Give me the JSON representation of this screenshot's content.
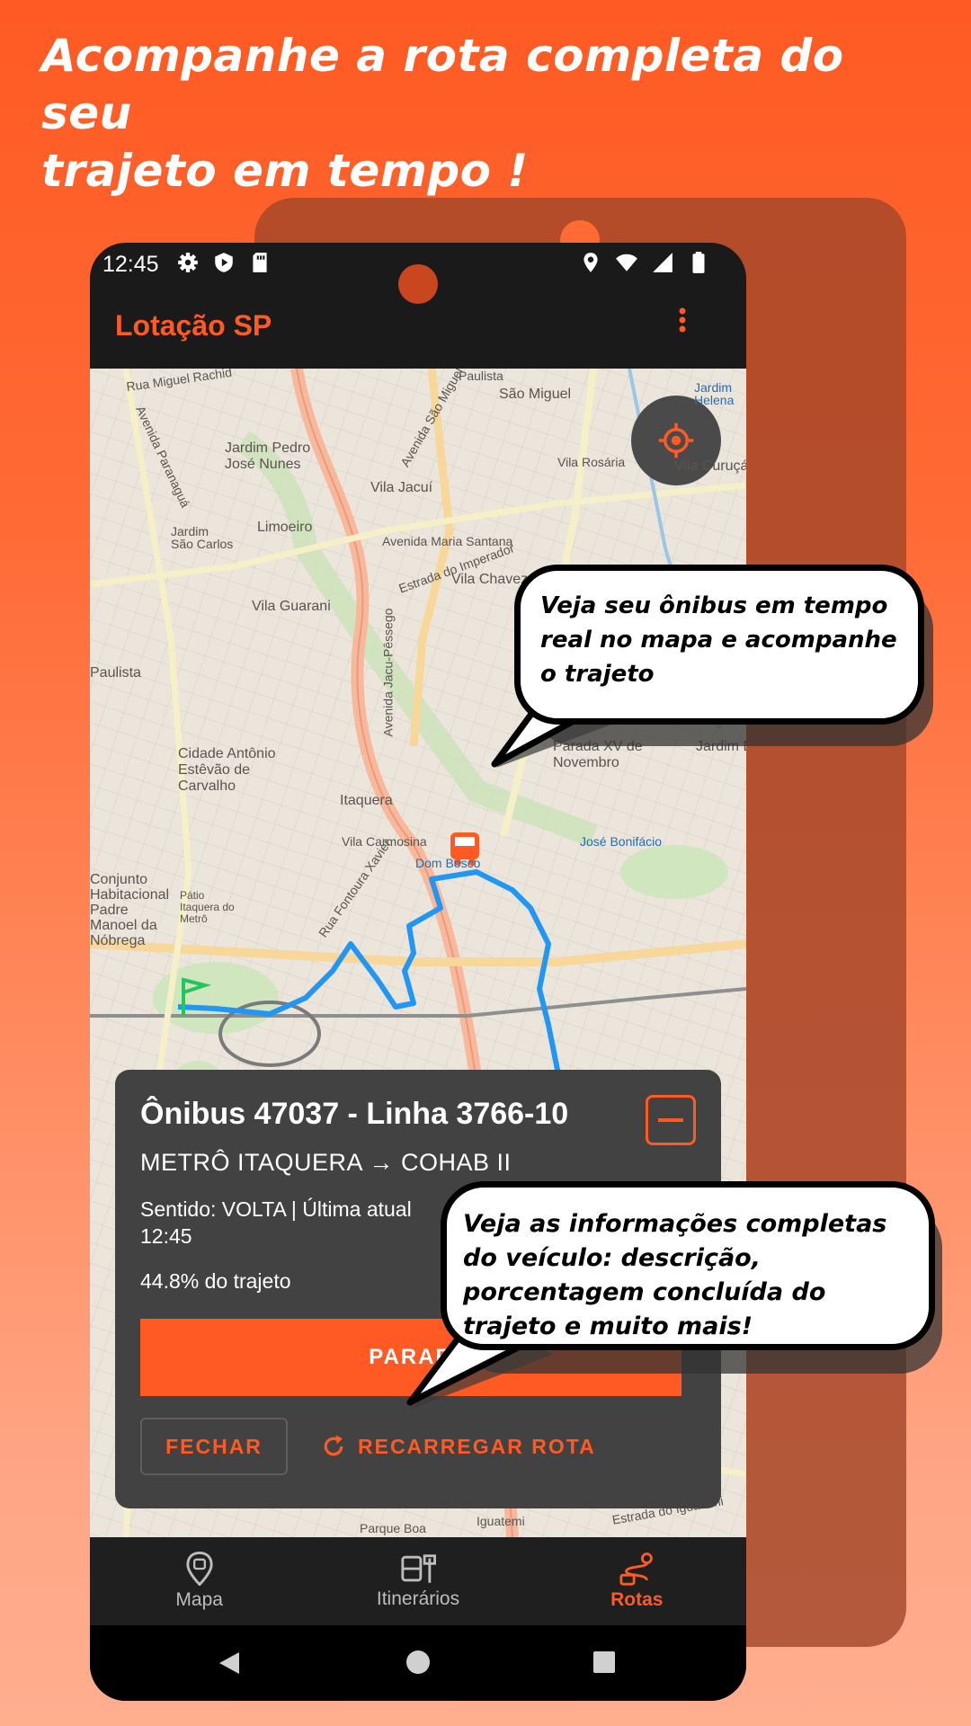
{
  "headline": {
    "line1": "Acompanhe a rota completa do seu",
    "line2": "trajeto em tempo !"
  },
  "status_bar": {
    "time": "12:45"
  },
  "app": {
    "title": "Lotação SP",
    "accent": "#ff5a23"
  },
  "map": {
    "labels": [
      "Rua Miguel Rachid",
      "Paulista",
      "São Miguel",
      "Jardim Helena",
      "Avenida Paranaguá",
      "Jardim Pedro José Nunes",
      "Avenida São Miguel",
      "Vila Rosária",
      "Vila Curuçá",
      "Vila Jacuí",
      "Jardim São Carlos",
      "Limoeiro",
      "Avenida Maria Santana",
      "Estrada do Imperador",
      "Vila Chavez",
      "Vila Guarani",
      "Paulista",
      "Avenida Jacu-Pêssego",
      "Parada XV de Novembro",
      "Jardim Et",
      "Cidade Antônio Estêvão de Carvalho",
      "Itaquera",
      "Vila Carmosina",
      "Dom Bosco",
      "José Bonifácio",
      "Conjunto Habitacional Padre Manoel da Nóbrega",
      "Pátio Itaquera do Metrô",
      "Rua Fontoura Xavier",
      "Iguatemi",
      "Estrada do Iguatemi",
      "Parque Boa"
    ]
  },
  "bubbles": {
    "top": "Veja seu ônibus em tempo real no mapa e acompanhe o trajeto",
    "bottom": "Veja as informações completas do veículo: descrição, porcentagem concluída do trajeto e muito mais!"
  },
  "card": {
    "title": "Ônibus 47037 - Linha 3766-10",
    "route": "METRÔ ITAQUERA → COHAB II",
    "meta": "Sentido: VOLTA | Última atual",
    "meta_time": "12:45",
    "progress": "44.8% do trajeto",
    "primary_button": "PARAR",
    "close_button": "FECHAR",
    "reload_button": "RECARREGAR ROTA"
  },
  "bottom_nav": [
    {
      "label": "Mapa",
      "icon": "bus-marker-icon",
      "active": false
    },
    {
      "label": "Itinerários",
      "icon": "bus-stop-icon",
      "active": false
    },
    {
      "label": "Rotas",
      "icon": "route-icon",
      "active": true
    }
  ]
}
